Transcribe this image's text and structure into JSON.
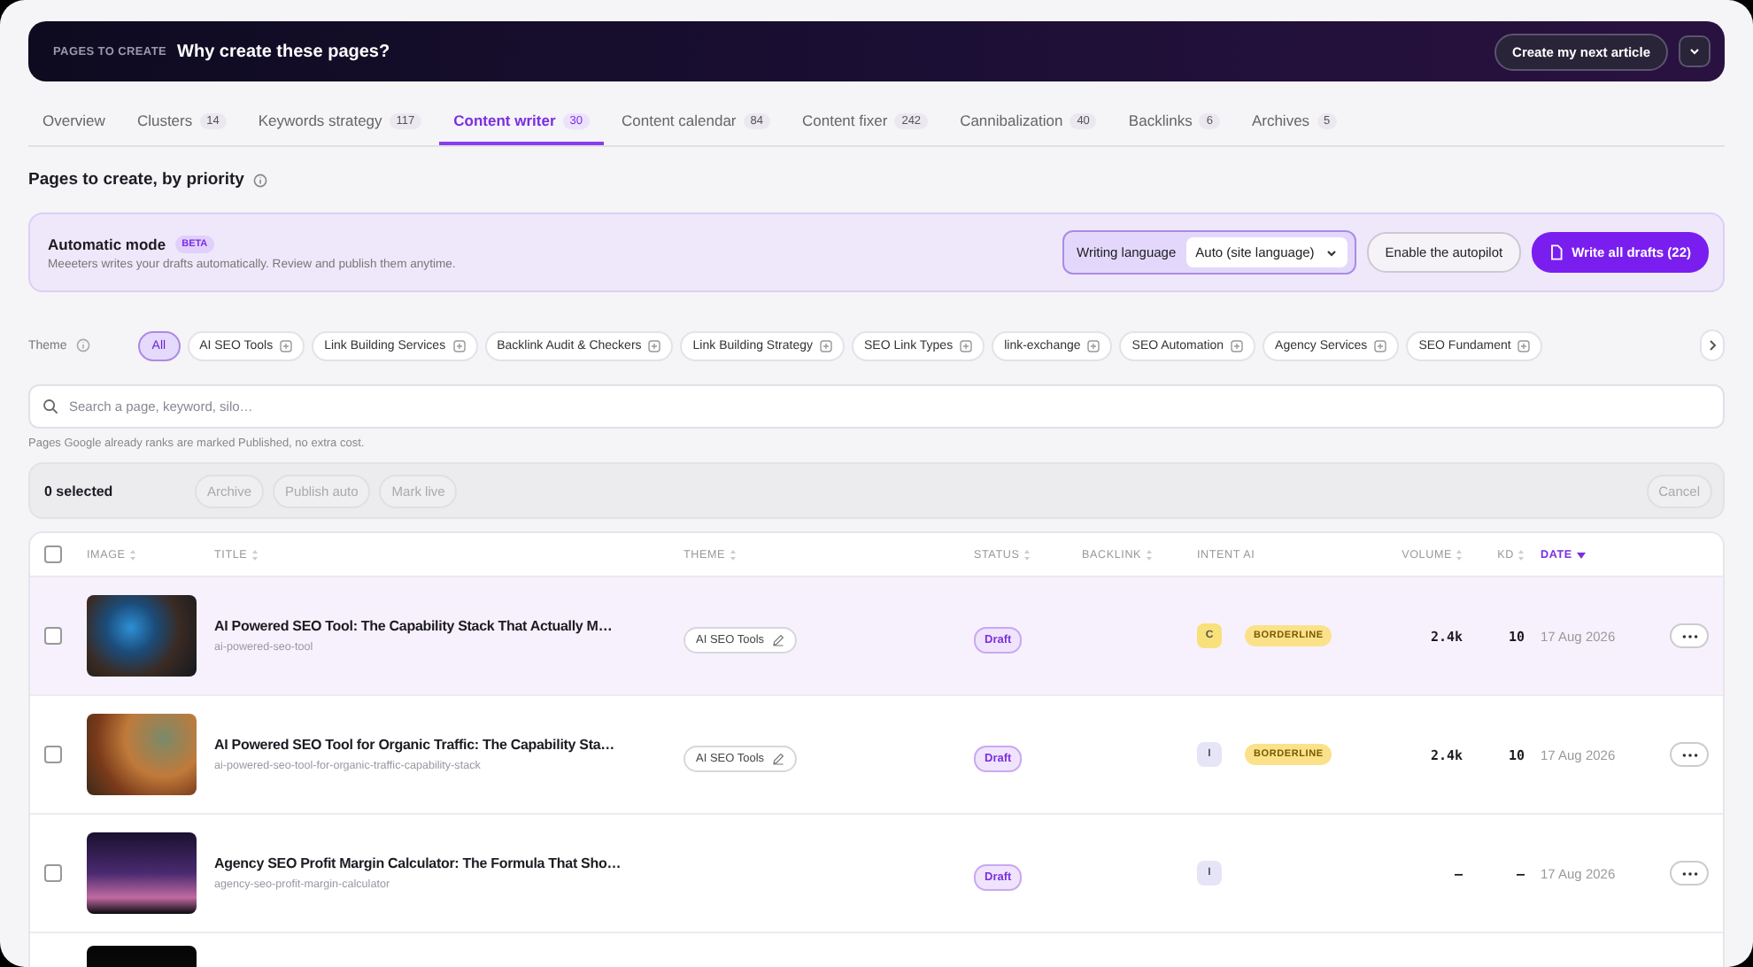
{
  "banner": {
    "eyebrow": "PAGES TO CREATE",
    "title": "Why create these pages?",
    "action": "Create my next article"
  },
  "tabs": [
    {
      "label": "Overview",
      "selected": false
    },
    {
      "label": "Clusters",
      "count": "14",
      "selected": false
    },
    {
      "label": "Keywords strategy",
      "count": "117",
      "selected": false
    },
    {
      "label": "Content writer",
      "count": "30",
      "selected": true
    },
    {
      "label": "Content calendar",
      "count": "84",
      "selected": false
    },
    {
      "label": "Content fixer",
      "count": "242",
      "selected": false
    },
    {
      "label": "Cannibalization",
      "count": "40",
      "selected": false
    },
    {
      "label": "Backlinks",
      "count": "6",
      "selected": false
    },
    {
      "label": "Archives",
      "count": "5",
      "selected": false
    }
  ],
  "section_title": "Pages to create, by priority",
  "automatic_mode": {
    "title": "Automatic mode",
    "badge": "BETA",
    "description": "Meeeters writes your drafts automatically. Review and publish them anytime.",
    "language_label": "Writing language",
    "language_value": "Auto (site language)",
    "autopilot_button": "Enable the autopilot",
    "write_button": "Write all drafts (22)"
  },
  "theme_filter": {
    "label": "Theme",
    "chips": [
      {
        "label": "All",
        "selected": true
      },
      {
        "label": "AI SEO Tools",
        "selected": false
      },
      {
        "label": "Link Building Services",
        "selected": false
      },
      {
        "label": "Backlink Audit & Checkers",
        "selected": false
      },
      {
        "label": "Link Building Strategy",
        "selected": false
      },
      {
        "label": "SEO Link Types",
        "selected": false
      },
      {
        "label": "link-exchange",
        "selected": false
      },
      {
        "label": "SEO Automation",
        "selected": false
      },
      {
        "label": "Agency Services",
        "selected": false
      },
      {
        "label": "SEO Fundament",
        "selected": false
      }
    ]
  },
  "search": {
    "placeholder": "Search a page, keyword, silo…"
  },
  "note": "Pages Google already ranks are marked Published, no extra cost.",
  "selection_bar": {
    "count": "0 selected",
    "actions": [
      {
        "label": "Archive",
        "disabled": true
      },
      {
        "label": "Publish auto",
        "disabled": true
      },
      {
        "label": "Mark live",
        "disabled": true
      }
    ],
    "cancel": {
      "label": "Cancel",
      "disabled": true
    }
  },
  "table": {
    "all_checked": false,
    "columns": [
      {
        "label": "IMAGE",
        "sortable": true,
        "sorted": false
      },
      {
        "label": "TITLE",
        "sortable": true,
        "sorted": false
      },
      {
        "label": "THEME",
        "sortable": true,
        "sorted": false
      },
      {
        "label": "STATUS",
        "sortable": true,
        "sorted": false
      },
      {
        "label": "BACKLINK",
        "sortable": true,
        "sorted": false
      },
      {
        "label": "INTENT AI",
        "sortable": false,
        "sorted": false
      },
      {
        "label": "VOLUME",
        "sortable": true,
        "sorted": false
      },
      {
        "label": "KD",
        "sortable": true,
        "sorted": false
      },
      {
        "label": "DATE",
        "sorted": true
      }
    ],
    "rows": [
      {
        "kind": "article",
        "checked": false,
        "highlighted": true,
        "title": "AI Powered SEO Tool: The Capability Stack That Actually M…",
        "slug": "ai-powered-seo-tool",
        "theme": "AI SEO Tools",
        "status": "Draft",
        "intent": {
          "letter": "C",
          "color": "#f8e07a"
        },
        "intent_label": "BORDERLINE",
        "volume": "2.4k",
        "kd": "10",
        "date": "17 Aug 2026"
      },
      {
        "kind": "article",
        "checked": false,
        "highlighted": false,
        "title": "AI Powered SEO Tool for Organic Traffic: The Capability Sta…",
        "slug": "ai-powered-seo-tool-for-organic-traffic-capability-stack",
        "theme": "AI SEO Tools",
        "status": "Draft",
        "intent": {
          "letter": "I",
          "color": "#e6e4f7"
        },
        "intent_label": "BORDERLINE",
        "volume": "2.4k",
        "kd": "10",
        "date": "17 Aug 2026"
      },
      {
        "kind": "article",
        "checked": false,
        "highlighted": false,
        "title": "Agency SEO Profit Margin Calculator: The Formula That Sho…",
        "slug": "agency-seo-profit-margin-calculator",
        "status": "Draft",
        "intent": {
          "letter": "I",
          "color": "#e6e4f7"
        },
        "volume": "–",
        "kd": "–",
        "date": "17 Aug 2026"
      },
      {
        "kind": "cut_off"
      }
    ]
  }
}
